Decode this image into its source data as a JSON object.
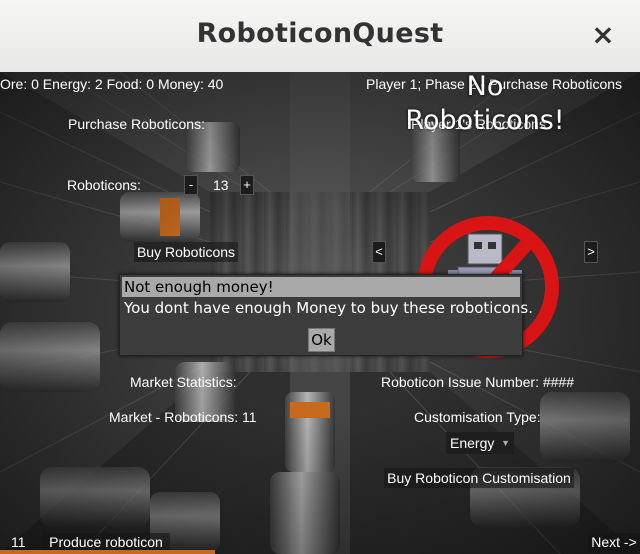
{
  "window": {
    "title": "RoboticonQuest",
    "close_glyph": "×"
  },
  "status": {
    "resources": "Ore: 0 Energy: 2 Food: 0 Money: 40",
    "phase": "Player 1; Phase 2 - Purchase Roboticons"
  },
  "purchase": {
    "heading": "Purchase Roboticons:",
    "roboticons_label": "Roboticons:",
    "minus": "-",
    "count": "13",
    "plus": "+",
    "buy_button": "Buy Roboticons"
  },
  "player_panel": {
    "heading": "Player 1's Roboticons:",
    "no_roboticons": "No Roboticons!",
    "prev": "<",
    "next": ">"
  },
  "dialog": {
    "title": "Not enough money!",
    "message": "You dont have enough Money to buy these roboticons.",
    "ok": "Ok"
  },
  "market": {
    "heading": "Market Statistics:",
    "roboticons": "Market - Roboticons: 11"
  },
  "customisation": {
    "issue_number": "Roboticon Issue Number: ####",
    "type_label": "Customisation Type:",
    "type_value": "Energy",
    "buy_button": "Buy Roboticon Customisation"
  },
  "footer": {
    "count": "11",
    "produce_button": "Produce roboticon",
    "next_button": "Next ->"
  },
  "colors": {
    "accent": "#c86a1e",
    "stop_sign": "#d81414",
    "dialog_bar": "#a9a9a9"
  }
}
